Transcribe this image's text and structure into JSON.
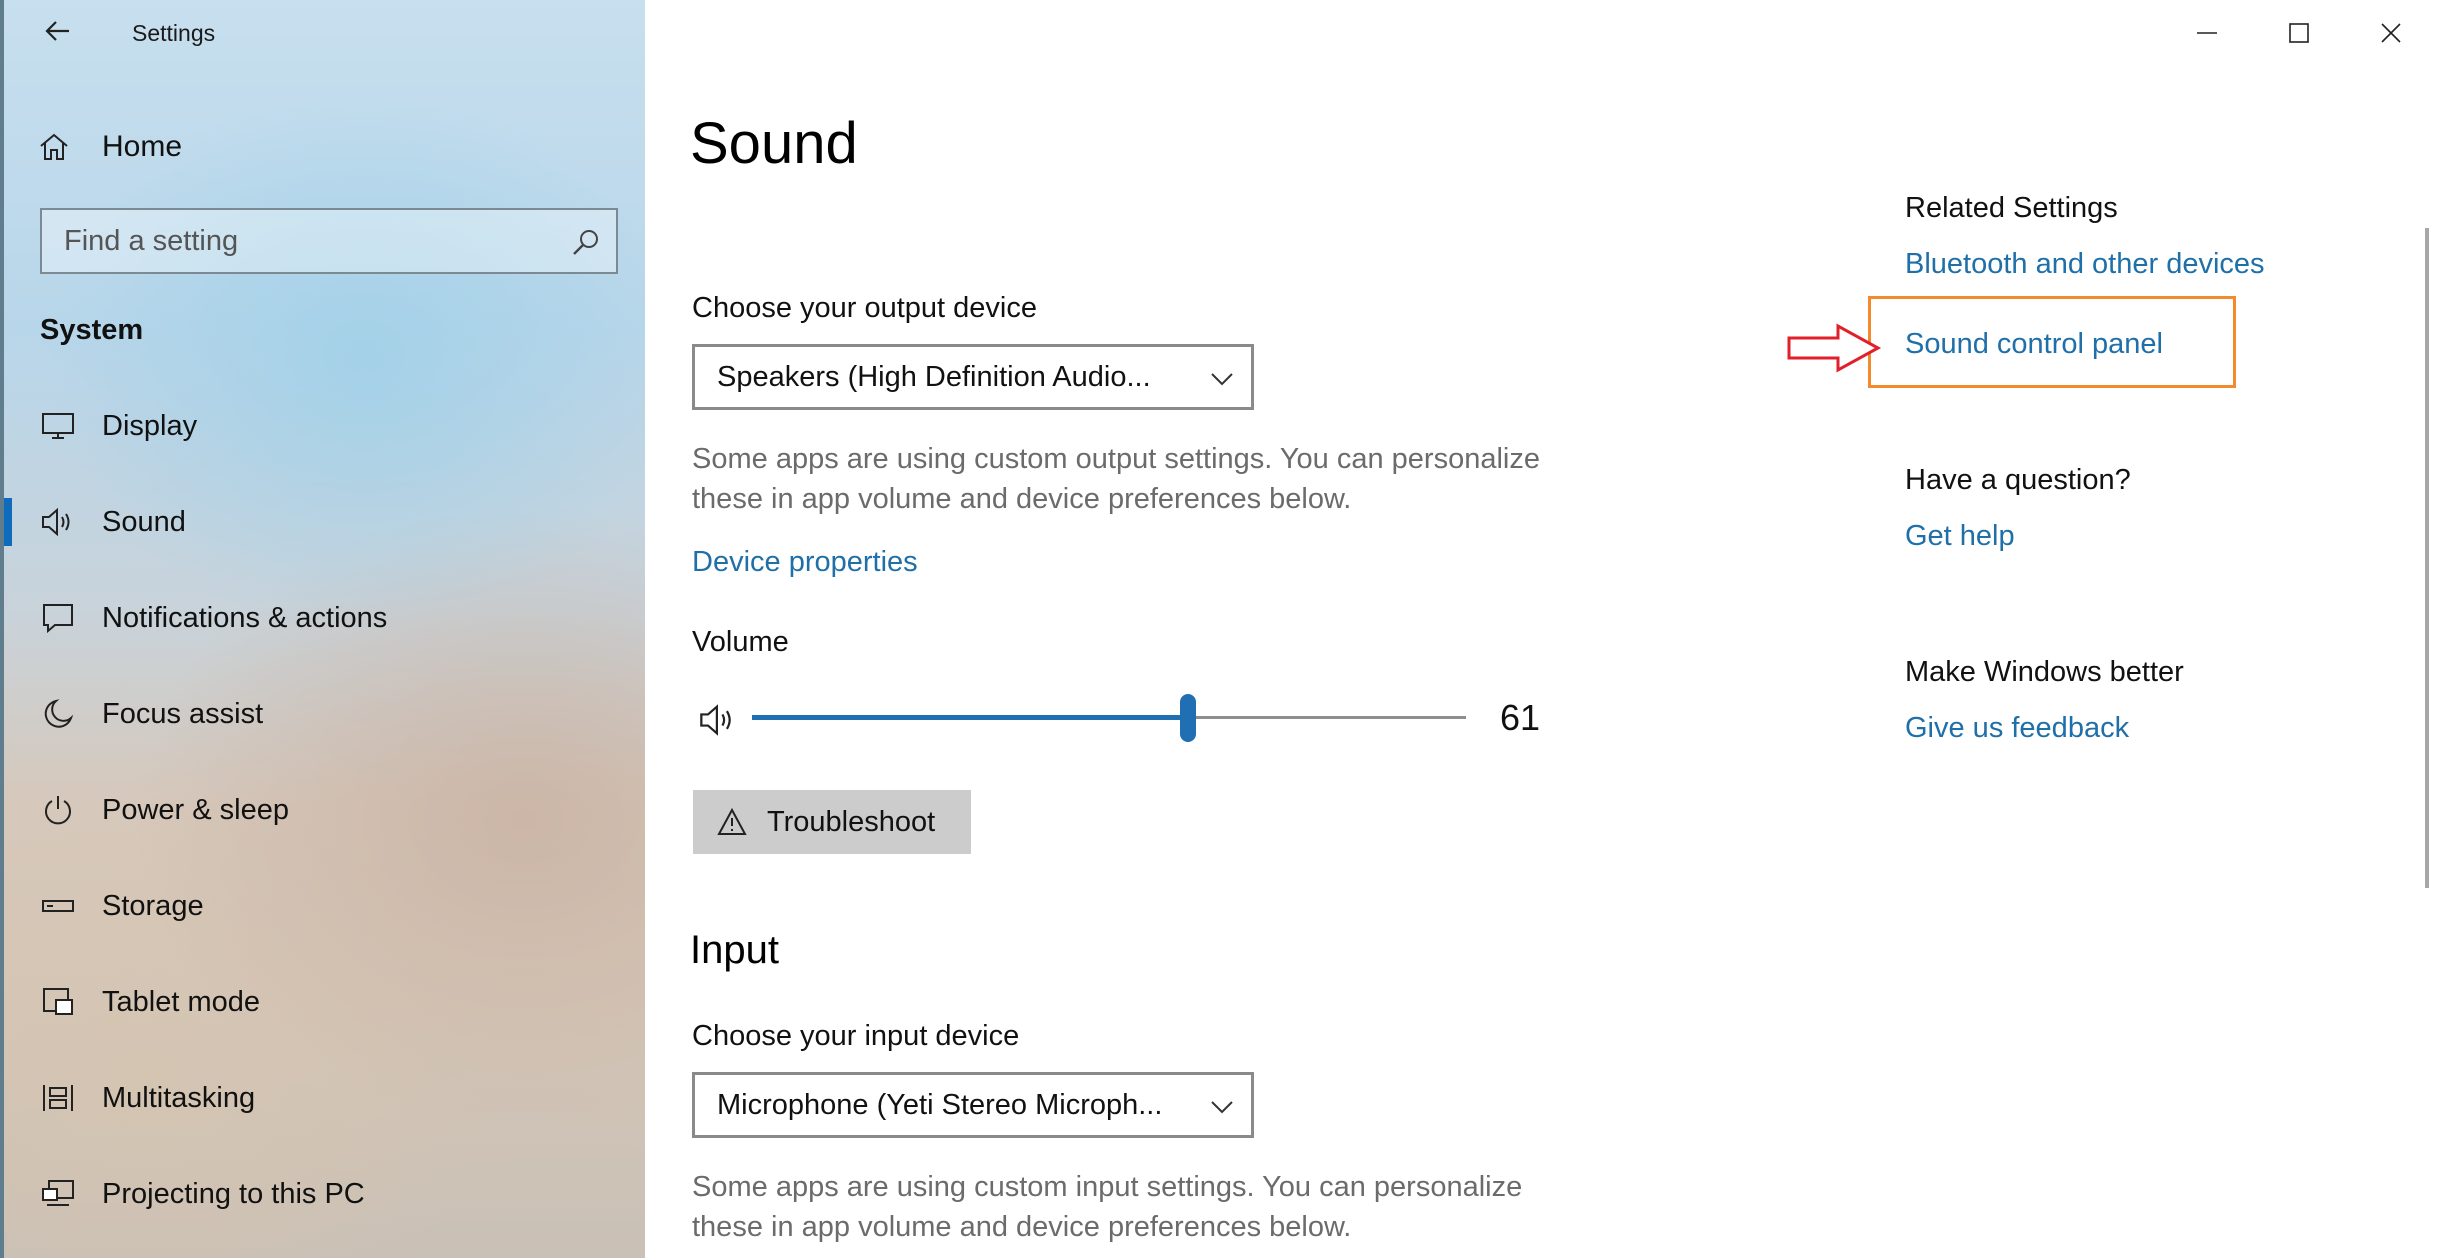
{
  "window": {
    "title": "Settings",
    "controls": {
      "minimize": "minimize",
      "maximize": "maximize",
      "close": "close"
    }
  },
  "sidebar": {
    "home_label": "Home",
    "search_placeholder": "Find a setting",
    "section_title": "System",
    "items": [
      {
        "label": "Display",
        "icon": "monitor-icon"
      },
      {
        "label": "Sound",
        "icon": "speaker-icon",
        "selected": true
      },
      {
        "label": "Notifications & actions",
        "icon": "notification-icon"
      },
      {
        "label": "Focus assist",
        "icon": "moon-icon"
      },
      {
        "label": "Power & sleep",
        "icon": "power-icon"
      },
      {
        "label": "Storage",
        "icon": "storage-icon"
      },
      {
        "label": "Tablet mode",
        "icon": "tablet-mode-icon"
      },
      {
        "label": "Multitasking",
        "icon": "multitasking-icon"
      },
      {
        "label": "Projecting to this PC",
        "icon": "projecting-icon"
      }
    ]
  },
  "main": {
    "title": "Sound",
    "output": {
      "label": "Choose your output device",
      "selected": "Speakers (High Definition Audio...",
      "description": "Some apps are using custom output settings. You can personalize these in app volume and device preferences below.",
      "device_properties_link": "Device properties",
      "volume_label": "Volume",
      "volume_value": "61",
      "volume_level": 0.61,
      "troubleshoot_label": "Troubleshoot"
    },
    "input": {
      "title": "Input",
      "label": "Choose your input device",
      "selected": "Microphone (Yeti Stereo Microph...",
      "description": "Some apps are using custom input settings. You can personalize these in app volume and device preferences below."
    }
  },
  "related": {
    "heading": "Related Settings",
    "links": [
      "Bluetooth and other devices",
      "Sound control panel"
    ],
    "question_heading": "Have a question?",
    "help_link": "Get help",
    "better_heading": "Make Windows better",
    "feedback_link": "Give us feedback"
  },
  "colors": {
    "accent": "#1f6fb2",
    "link": "#1f6fa8",
    "highlight_box": "#f28a2e",
    "annotation_arrow": "#e0202a"
  }
}
